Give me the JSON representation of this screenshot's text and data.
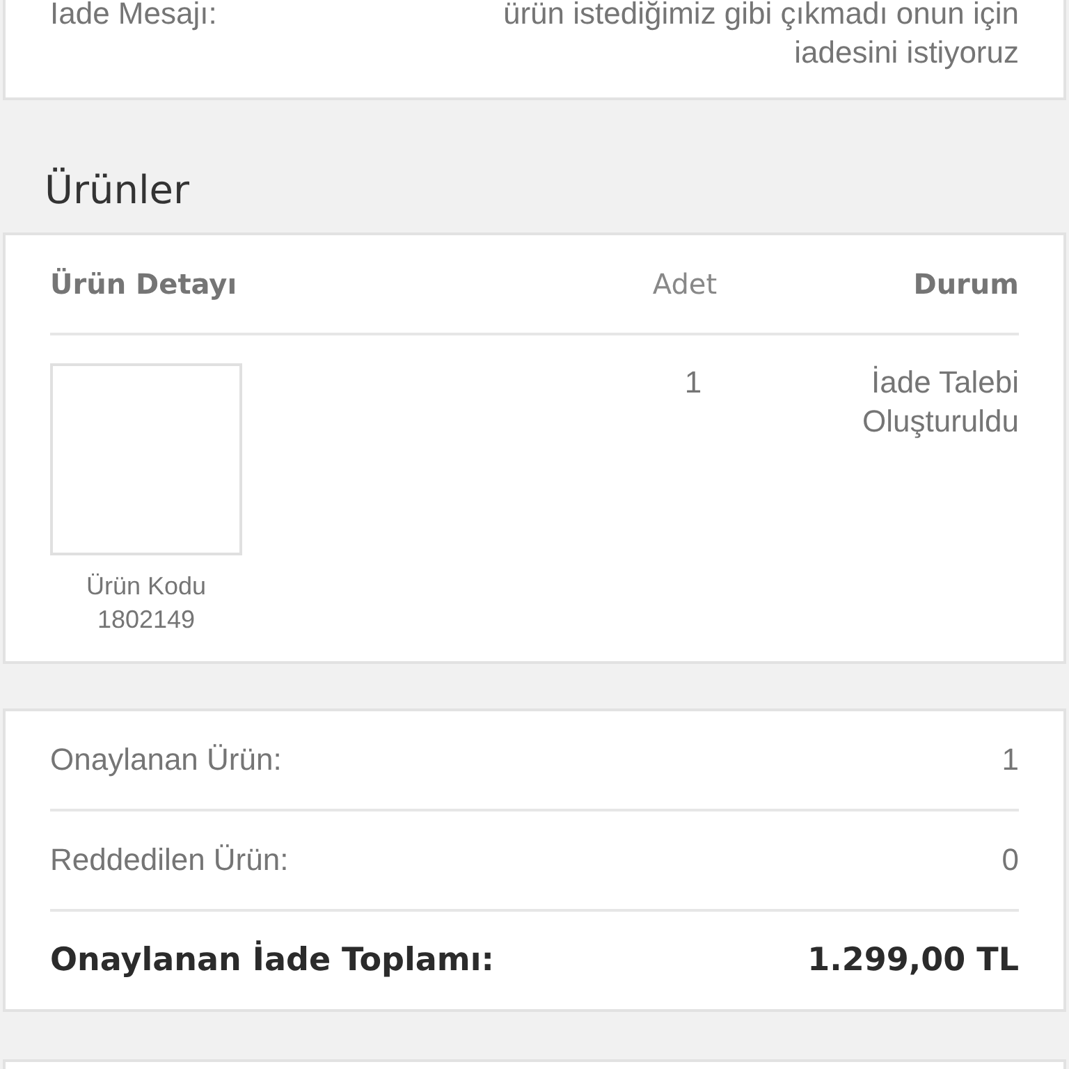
{
  "return_message": {
    "label": "İade Mesajı:",
    "value": "ürün istediğimiz gibi çıkmadı onun için iadesini istiyoruz"
  },
  "products_section": {
    "title": "Ürünler",
    "columns": [
      "Ürün Detayı",
      "Adet",
      "Durum"
    ],
    "rows": [
      {
        "code_label": "Ürün Kodu",
        "code": "1802149",
        "quantity": "1",
        "status": "İade Talebi Oluşturuldu"
      }
    ]
  },
  "summary": {
    "rows": [
      {
        "label": "Onaylanan Ürün:",
        "value": "1"
      },
      {
        "label": "Reddedilen Ürün:",
        "value": "0"
      }
    ],
    "total": {
      "label": "Onaylanan İade Toplamı:",
      "value": "1.299,00 TL"
    }
  }
}
